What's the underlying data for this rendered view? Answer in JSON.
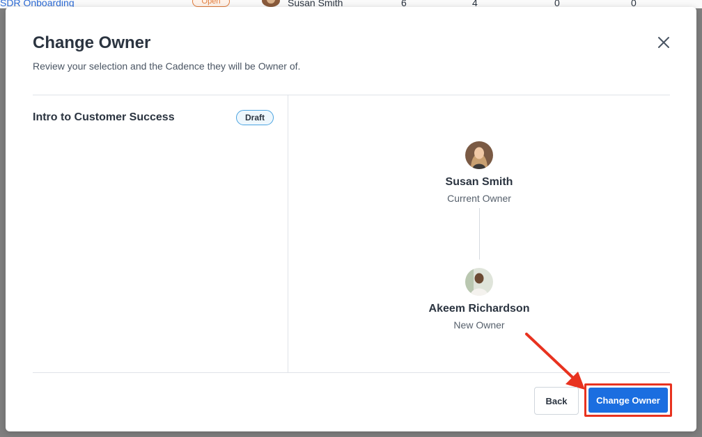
{
  "background": {
    "link_text": "SDR Onboarding",
    "status_pill": "Open",
    "owner_name": "Susan Smith",
    "counts": [
      "6",
      "4",
      "0",
      "0"
    ]
  },
  "modal": {
    "title": "Change Owner",
    "subtitle": "Review your selection and the Cadence they will be Owner of.",
    "close_icon": "close-icon"
  },
  "cadence": {
    "name": "Intro to Customer Success",
    "status": "Draft"
  },
  "current_owner": {
    "name": "Susan Smith",
    "role": "Current Owner"
  },
  "new_owner": {
    "name": "Akeem Richardson",
    "role": "New Owner"
  },
  "footer": {
    "back_label": "Back",
    "change_label": "Change Owner"
  },
  "colors": {
    "primary": "#1b6ee0",
    "highlight": "#e8321f",
    "badge_border": "#4aa3e0"
  }
}
